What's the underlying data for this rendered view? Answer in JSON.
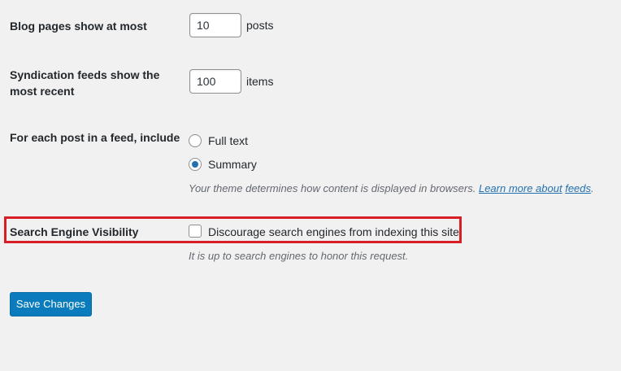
{
  "blog_pages": {
    "label": "Blog pages show at most",
    "value": "10",
    "unit": "posts"
  },
  "syndication": {
    "label_line1": "Syndication feeds show the",
    "label_line2": "most recent",
    "value": "100",
    "unit": "items"
  },
  "feed_content": {
    "label": "For each post in a feed, include",
    "options": [
      {
        "label": "Full text",
        "checked": false
      },
      {
        "label": "Summary",
        "checked": true
      }
    ],
    "description_prefix": "Your theme determines how content is displayed in browsers. ",
    "link1": "Learn more about",
    "link_space": " ",
    "link2": "feeds",
    "description_suffix": "."
  },
  "search_visibility": {
    "label": "Search Engine Visibility",
    "checkbox_label": "Discourage search engines from indexing this site",
    "checked": false,
    "description": "It is up to search engines to honor this request."
  },
  "save_button": "Save Changes",
  "colors": {
    "accent": "#2271b1",
    "button": "#0a7cbe",
    "highlight": "#d81f26",
    "background": "#f1f1f1"
  }
}
